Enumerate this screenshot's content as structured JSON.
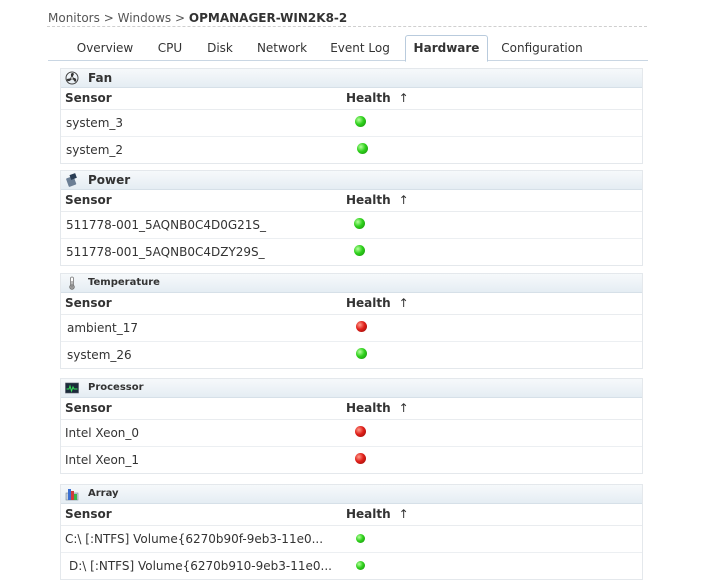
{
  "breadcrumb": {
    "monitors": "Monitors",
    "sep1": ">",
    "windows": "Windows",
    "sep2": ">",
    "device": "OPMANAGER-WIN2K8-2"
  },
  "tabs": [
    "Overview",
    "CPU",
    "Disk",
    "Network",
    "Event Log",
    "Hardware",
    "Configuration"
  ],
  "active_tab": "Hardware",
  "columns": {
    "sensor": "Sensor",
    "health": "Health",
    "sort_arrow": "↑"
  },
  "status_colors": {
    "ok": "#2fd11c",
    "critical": "#e0201a"
  },
  "sections": [
    {
      "title": "Fan",
      "icon": "fan-icon",
      "rows": [
        {
          "sensor": "system_3",
          "health": "ok"
        },
        {
          "sensor": "system_2",
          "health": "ok"
        }
      ]
    },
    {
      "title": "Power",
      "icon": "power-icon",
      "rows": [
        {
          "sensor": "511778-001_5AQNB0C4D0G21S_",
          "health": "ok"
        },
        {
          "sensor": "511778-001_5AQNB0C4DZY29S_",
          "health": "ok"
        }
      ]
    },
    {
      "title": "Temperature",
      "icon": "thermometer-icon",
      "rows": [
        {
          "sensor": "ambient_17",
          "health": "critical"
        },
        {
          "sensor": "system_26",
          "health": "ok"
        }
      ]
    },
    {
      "title": "Processor",
      "icon": "processor-icon",
      "rows": [
        {
          "sensor": "Intel Xeon_0",
          "health": "critical"
        },
        {
          "sensor": "Intel Xeon_1",
          "health": "critical"
        }
      ]
    },
    {
      "title": "Array",
      "icon": "array-icon",
      "rows": [
        {
          "sensor": "C:\\ [:NTFS] Volume{6270b90f-9eb3-11e0...",
          "health": "ok"
        },
        {
          "sensor": "D:\\ [:NTFS] Volume{6270b910-9eb3-11e0...",
          "health": "ok"
        }
      ]
    }
  ]
}
